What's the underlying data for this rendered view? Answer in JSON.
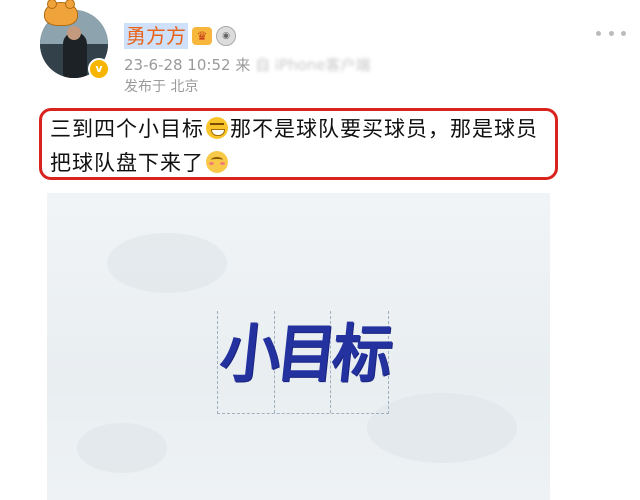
{
  "author": {
    "name": "勇方方",
    "timestamp": "23-6-28 10:52",
    "source_partial": "来",
    "obscured_text": "自 iPhone客户端",
    "location_prefix": "发布于",
    "location": "北京",
    "badges": [
      "crown-icon",
      "medal-icon",
      "verified-icon"
    ]
  },
  "post": {
    "text_part1": "三到四个小目标",
    "text_part2": "那不是球队要买球员，那是球员把球队盘下来了",
    "emojis": [
      "grin-emoji",
      "blush-emoji"
    ]
  },
  "image": {
    "logo_text": "小目标"
  },
  "colors": {
    "highlight_box": "#d8231f",
    "username": "#e8641b",
    "logo": "#2432a0"
  }
}
